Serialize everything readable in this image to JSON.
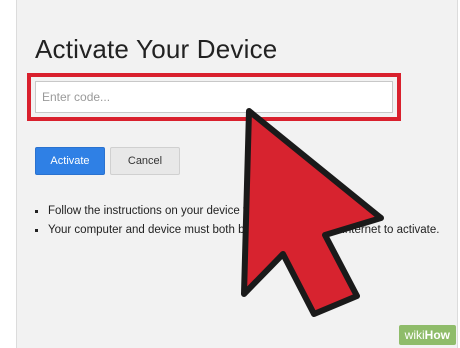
{
  "page": {
    "title": "Activate Your Device"
  },
  "code_field": {
    "placeholder": "Enter code...",
    "value": ""
  },
  "buttons": {
    "activate_label": "Activate",
    "cancel_label": "Cancel"
  },
  "instructions": [
    "Follow the instructions on your device to activate.",
    "Your computer and device must both be connected to the internet to activate."
  ],
  "overlay": {
    "pointer_icon": "large-arrow-pointer-icon",
    "highlight_color": "#d9202d"
  },
  "watermark": {
    "prefix": "wiki",
    "suffix": "How"
  },
  "colors": {
    "accent_blue": "#2f80e5",
    "highlight_red": "#d9202d",
    "background": "#f2f2f2"
  }
}
